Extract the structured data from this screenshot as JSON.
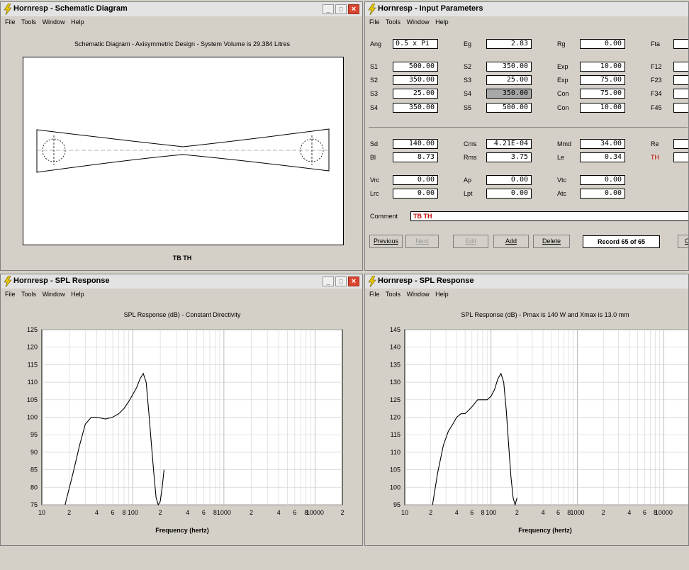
{
  "schematic": {
    "window_title": "Hornresp - Schematic Diagram",
    "menu": [
      "File",
      "Tools",
      "Window",
      "Help"
    ],
    "heading": "Schematic Diagram - Axisymmetric Design - System Volume is 29.384 Litres",
    "caption": "TB TH"
  },
  "params": {
    "window_title": "Hornresp - Input Parameters",
    "menu": [
      "File",
      "Tools",
      "Window",
      "Help"
    ],
    "rows": [
      {
        "c1": "Ang",
        "v1": "0.5 x Pi",
        "c2": "Eg",
        "v2": "2.83",
        "c3": "Rg",
        "v3": "0.00",
        "c4": "Fta"
      },
      {
        "c1": "S1",
        "v1": "500.00",
        "c2": "S2",
        "v2": "350.00",
        "c3": "Exp",
        "v3": "10.00",
        "c4": "F12"
      },
      {
        "c1": "S2",
        "v1": "350.00",
        "c2": "S3",
        "v2": "25.00",
        "c3": "Exp",
        "v3": "75.00",
        "c4": "F23"
      },
      {
        "c1": "S3",
        "v1": "25.00",
        "c2": "S4",
        "v2": "350.00",
        "c3": "Con",
        "v3": "75.00",
        "c4": "F34"
      },
      {
        "c1": "S4",
        "v1": "350.00",
        "c2": "S5",
        "v2": "500.00",
        "c3": "Con",
        "v3": "10.00",
        "c4": "F45"
      },
      {
        "c1": "Sd",
        "v1": "140.00",
        "c2": "Cms",
        "v2": "4.21E-04",
        "c3": "Mmd",
        "v3": "34.00",
        "c4": "Re"
      },
      {
        "c1": "Bl",
        "v1": "8.73",
        "c2": "Rms",
        "v2": "3.75",
        "c3": "Le",
        "v3": "0.34",
        "c4": "TH"
      },
      {
        "c1": "Vrc",
        "v1": "0.00",
        "c2": "Ap",
        "v2": "0.00",
        "c3": "Vtc",
        "v3": "0.00",
        "c4": ""
      },
      {
        "c1": "Lrc",
        "v1": "0.00",
        "c2": "Lpt",
        "v2": "0.00",
        "c3": "Atc",
        "v3": "0.00",
        "c4": ""
      }
    ],
    "comment_label": "Comment",
    "comment_value": "TB TH",
    "buttons": {
      "previous": "Previous",
      "next": "Next",
      "edit": "Edit",
      "add": "Add",
      "delete": "Delete",
      "c": "C"
    },
    "record": "Record 65 of 65",
    "accent_red": "#c00000"
  },
  "spl1": {
    "window_title": "Hornresp - SPL Response",
    "menu": [
      "File",
      "Tools",
      "Window",
      "Help"
    ],
    "xlabel": "Frequency (hertz)"
  },
  "spl2": {
    "window_title": "Hornresp - SPL Response",
    "menu": [
      "File",
      "Tools",
      "Window",
      "Help"
    ],
    "xlabel": "Frequency (hertz)"
  },
  "chart_data": [
    {
      "type": "line",
      "title": "SPL Response (dB) - Constant Directivity",
      "xlabel": "Frequency (hertz)",
      "ylabel": "",
      "xscale": "log",
      "xlim": [
        10,
        20000
      ],
      "ylim": [
        75,
        125
      ],
      "yticks": [
        75,
        80,
        85,
        90,
        95,
        100,
        105,
        110,
        115,
        120,
        125
      ],
      "xtick_labels": [
        "10",
        "2",
        "4",
        "6",
        "8",
        "100",
        "2",
        "4",
        "6",
        "8",
        "1000",
        "2",
        "4",
        "6",
        "8",
        "10000",
        "2"
      ],
      "xtick_values": [
        10,
        20,
        40,
        60,
        80,
        100,
        200,
        400,
        600,
        800,
        1000,
        2000,
        4000,
        6000,
        8000,
        10000,
        20000
      ],
      "grid": true,
      "series": [
        {
          "color": "#000000",
          "x": [
            18,
            22,
            26,
            30,
            35,
            40,
            50,
            60,
            70,
            80,
            90,
            100,
            110,
            120,
            130,
            140,
            150,
            160,
            170,
            180,
            190,
            200,
            210,
            220
          ],
          "y": [
            75,
            84,
            92,
            98,
            100,
            100,
            99.5,
            100,
            101,
            102.5,
            104.5,
            106.5,
            108.5,
            111,
            112.5,
            110,
            101,
            92,
            84,
            77,
            75,
            76,
            80,
            85
          ]
        }
      ]
    },
    {
      "type": "line",
      "title": "SPL Response (dB) - Pmax is 140 W and Xmax is 13.0 mm",
      "xlabel": "Frequency (hertz)",
      "ylabel": "",
      "xscale": "log",
      "xlim": [
        10,
        20000
      ],
      "ylim": [
        95,
        145
      ],
      "yticks": [
        95,
        100,
        105,
        110,
        115,
        120,
        125,
        130,
        135,
        140,
        145
      ],
      "xtick_labels": [
        "10",
        "2",
        "4",
        "6",
        "8",
        "100",
        "2",
        "4",
        "6",
        "8",
        "1000",
        "2",
        "4",
        "6",
        "8",
        "10000",
        "2"
      ],
      "xtick_values": [
        10,
        20,
        40,
        60,
        80,
        100,
        200,
        400,
        600,
        800,
        1000,
        2000,
        4000,
        6000,
        8000,
        10000,
        20000
      ],
      "grid": true,
      "series": [
        {
          "color": "#000000",
          "x": [
            21,
            24,
            28,
            32,
            36,
            40,
            45,
            50,
            55,
            60,
            70,
            80,
            90,
            100,
            110,
            120,
            130,
            140,
            150,
            160,
            170,
            180,
            190,
            200
          ],
          "y": [
            95,
            104,
            112,
            116,
            118,
            120,
            121,
            121,
            122,
            123,
            125,
            125,
            125,
            126,
            128,
            131,
            132.5,
            130,
            122,
            112,
            103,
            97,
            95,
            97
          ]
        }
      ]
    }
  ]
}
